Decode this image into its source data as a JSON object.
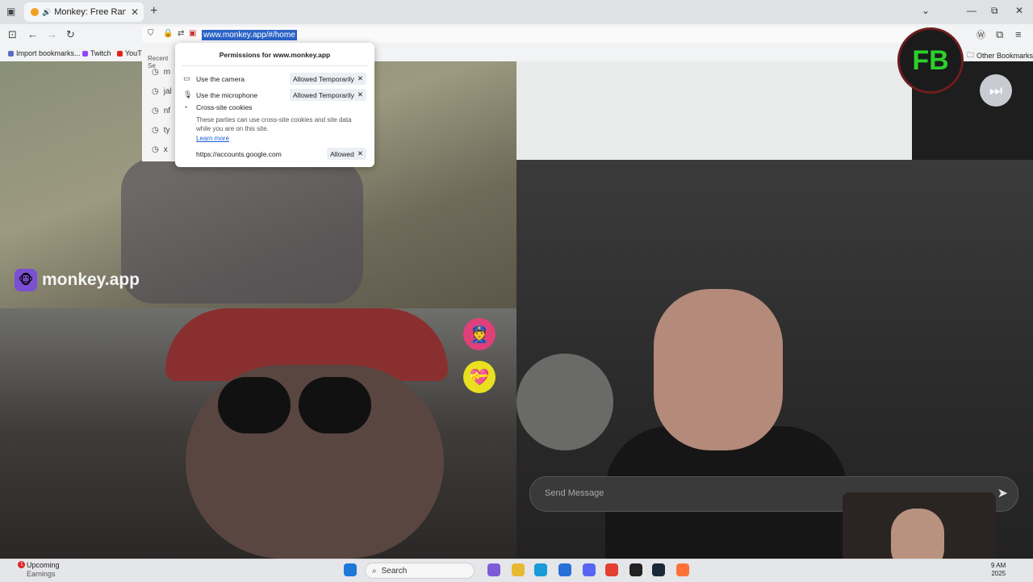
{
  "tab": {
    "title": "Monkey: Free Random Vide",
    "close": "✕",
    "new": "+"
  },
  "window": {
    "minimize": "—",
    "maximize": "⧉",
    "close": "✕",
    "chevron": "⌄"
  },
  "nav": {
    "back": "←",
    "forward": "→",
    "reload": "↻"
  },
  "url": "www.monkey.app/#/home",
  "bookmarks": [
    {
      "label": "Import bookmarks...",
      "color": "#5a6cc8"
    },
    {
      "label": "Twitch",
      "color": "#9146ff"
    },
    {
      "label": "YouT",
      "color": "#e62117"
    }
  ],
  "other_bookmarks": "Other Bookmarks",
  "recent": {
    "title": "Recent Se",
    "items": [
      "m",
      "jal",
      "nf",
      "ty",
      "x"
    ]
  },
  "permissions": {
    "title": "Permissions for www.monkey.app",
    "camera": {
      "label": "Use the camera",
      "status": "Allowed Temporarily"
    },
    "microphone": {
      "label": "Use the microphone",
      "status": "Allowed Temporarily"
    },
    "cookies": {
      "label": "Cross-site cookies",
      "description": "These parties can use cross-site cookies and site data while you are on this site.",
      "learn_more": "Learn more",
      "site": "https://accounts.google.com",
      "status": "Allowed"
    }
  },
  "app": {
    "logo_text": "monkey.app",
    "message_placeholder": "Send Message",
    "send_icon": "➤"
  },
  "streamer_badge": "FB",
  "taskbar": {
    "widget_title": "Upcoming",
    "widget_sub": "Earnings",
    "badge": "1",
    "search": "Search",
    "time": "9 AM",
    "date": "2025"
  }
}
